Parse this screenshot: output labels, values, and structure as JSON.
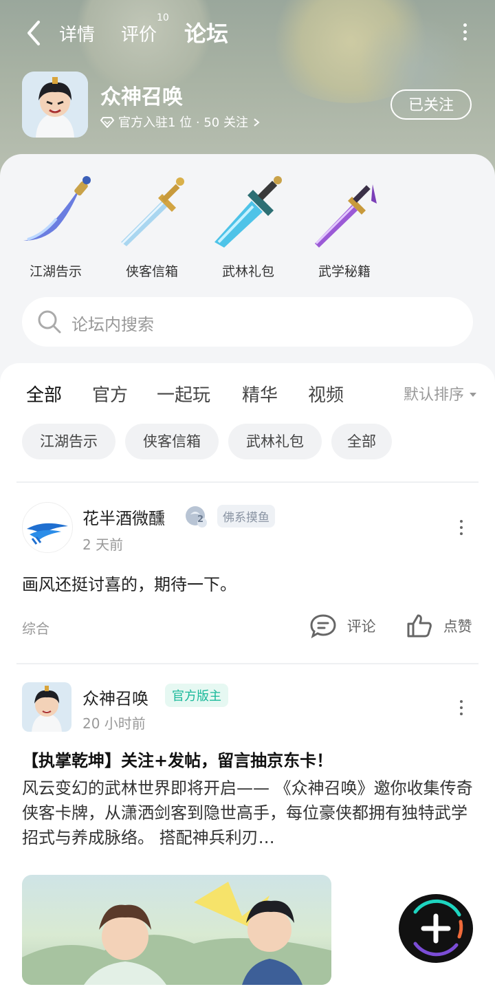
{
  "nav": {
    "tabs": [
      {
        "label": "详情"
      },
      {
        "label": "评价",
        "count": "10"
      },
      {
        "label": "论坛"
      }
    ]
  },
  "game": {
    "title": "众神召唤",
    "meta": "官方入驻1 位 · 50 关注",
    "follow_label": "已关注"
  },
  "categories": [
    {
      "label": "江湖告示",
      "icon": "blade-icon"
    },
    {
      "label": "侠客信箱",
      "icon": "sword-icon"
    },
    {
      "label": "武林礼包",
      "icon": "broadsword-icon"
    },
    {
      "label": "武学秘籍",
      "icon": "purple-sword-icon"
    }
  ],
  "search": {
    "placeholder": "论坛内搜索"
  },
  "feed": {
    "tabs": [
      "全部",
      "官方",
      "一起玩",
      "精华",
      "视频"
    ],
    "sort_label": "默认排序",
    "chips": [
      "江湖告示",
      "侠客信箱",
      "武林礼包",
      "全部"
    ]
  },
  "posts": [
    {
      "author": "花半酒微醺",
      "level": "2",
      "tag": "佛系摸鱼",
      "time": "2 天前",
      "text": "画风还挺讨喜的，期待一下。",
      "category": "综合",
      "comment_label": "评论",
      "like_label": "点赞"
    },
    {
      "author": "众神召唤",
      "tag": "官方版主",
      "time": "20 小时前",
      "title": "【执掌乾坤】关注+发帖，留言抽京东卡！",
      "body": "风云变幻的武林世界即将开启—— 《众神召唤》邀你收集传奇侠客卡牌，从潇洒剑客到隐世高手，每位豪侠都拥有独特武学招式与养成脉络。 搭配神兵利刃…"
    }
  ],
  "colors": {
    "accent": "#1ed5c0",
    "badge_official_bg": "#e6f8f2",
    "badge_official_fg": "#19b89a"
  }
}
